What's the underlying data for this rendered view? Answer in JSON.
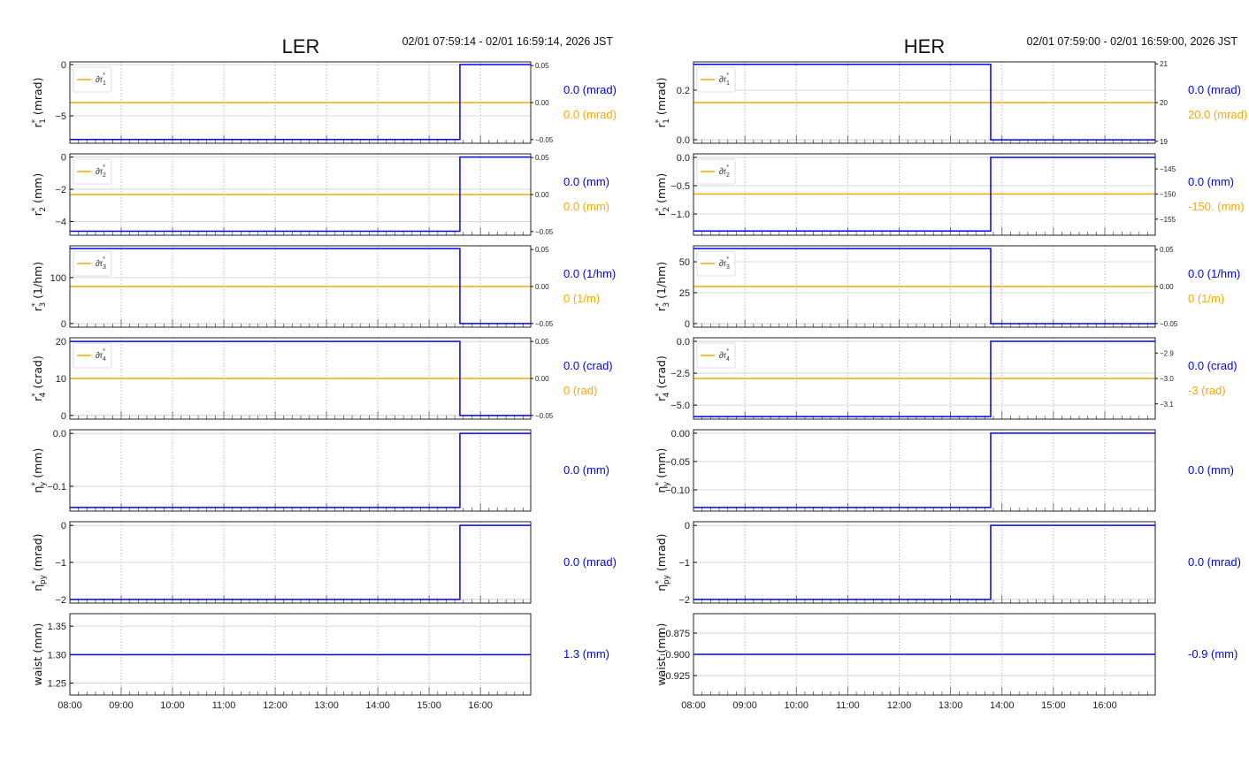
{
  "colors": {
    "primary": "#0000ff",
    "secondary": "#ffa500",
    "grid": "#cccccc"
  },
  "chart_data": [
    {
      "type": "line",
      "title": "LER",
      "time_range": "02/01 07:59:14 - 02/01 16:59:14, 2026 JST",
      "xlim_hours": [
        8.0,
        16.98
      ],
      "xticks": [
        {
          "v": 8,
          "label": "08:00"
        },
        {
          "v": 9,
          "label": "09:00"
        },
        {
          "v": 10,
          "label": "10:00"
        },
        {
          "v": 11,
          "label": "11:00"
        },
        {
          "v": 12,
          "label": "12:00"
        },
        {
          "v": 13,
          "label": "13:00"
        },
        {
          "v": 14,
          "label": "14:00"
        },
        {
          "v": 15,
          "label": "15:00"
        },
        {
          "v": 16,
          "label": "16:00"
        }
      ],
      "subplots": [
        {
          "ylabel": {
            "sym": "r",
            "sup": "*",
            "sub": "1",
            "unit": " (mrad)"
          },
          "ylim": [
            -7.67,
            0.26
          ],
          "yticks": [
            {
              "v": 0,
              "label": "0"
            },
            {
              "v": -5,
              "label": "−5"
            }
          ],
          "blue": {
            "x": [
              8.0,
              15.6,
              16.98
            ],
            "y": [
              -7.3,
              0.0,
              0.0
            ]
          },
          "orange": {
            "value": 0.0,
            "right_ylim": [
              -0.055,
              0.055
            ],
            "right_ticks": [
              {
                "v": 0.05,
                "label": "0.05"
              },
              {
                "v": 0.0,
                "label": "0.00"
              },
              {
                "v": -0.05,
                "label": "−0.05"
              }
            ]
          },
          "legend": {
            "sym": "∂r",
            "sup": "*",
            "sub": "1"
          },
          "annotations": {
            "blue": "0.0 (mrad)",
            "orange": "0.0 (mrad)"
          }
        },
        {
          "ylabel": {
            "sym": "r",
            "sup": "*",
            "sub": "2",
            "unit": " (mm)"
          },
          "ylim": [
            -4.85,
            0.2
          ],
          "yticks": [
            {
              "v": 0,
              "label": "0"
            },
            {
              "v": -2,
              "label": "−2"
            },
            {
              "v": -4,
              "label": "−4"
            }
          ],
          "blue": {
            "x": [
              8.0,
              15.6,
              16.98
            ],
            "y": [
              -4.6,
              0.0,
              0.0
            ]
          },
          "orange": {
            "value": 0.0,
            "right_ylim": [
              -0.055,
              0.055
            ],
            "right_ticks": [
              {
                "v": 0.05,
                "label": "0.05"
              },
              {
                "v": 0.0,
                "label": "0.00"
              },
              {
                "v": -0.05,
                "label": "−0.05"
              }
            ]
          },
          "legend": {
            "sym": "∂r",
            "sup": "*",
            "sub": "2"
          },
          "annotations": {
            "blue": "0.0 (mm)",
            "orange": "0.0 (mm)"
          }
        },
        {
          "ylabel": {
            "sym": "r",
            "sup": "*",
            "sub": "3",
            "unit": " (1/hm)"
          },
          "ylim": [
            -8,
            169
          ],
          "yticks": [
            {
              "v": 100,
              "label": "100"
            },
            {
              "v": 0,
              "label": "0"
            }
          ],
          "blue": {
            "x": [
              8.0,
              15.6,
              16.98
            ],
            "y": [
              163,
              0.0,
              0.0
            ]
          },
          "orange": {
            "value": 0.0,
            "right_ylim": [
              -0.055,
              0.055
            ],
            "right_ticks": [
              {
                "v": 0.05,
                "label": "0.05"
              },
              {
                "v": 0.0,
                "label": "0.00"
              },
              {
                "v": -0.05,
                "label": "−0.05"
              }
            ]
          },
          "legend": {
            "sym": "∂r",
            "sup": "*",
            "sub": "3"
          },
          "annotations": {
            "blue": "0.0 (1/hm)",
            "orange": "0 (1/m)"
          }
        },
        {
          "ylabel": {
            "sym": "r",
            "sup": "*",
            "sub": "4",
            "unit": " (crad)"
          },
          "ylim": [
            -1,
            21
          ],
          "yticks": [
            {
              "v": 20,
              "label": "20"
            },
            {
              "v": 10,
              "label": "10"
            },
            {
              "v": 0,
              "label": "0"
            }
          ],
          "blue": {
            "x": [
              8.0,
              15.6,
              16.98
            ],
            "y": [
              20,
              0.0,
              0.0
            ]
          },
          "orange": {
            "value": 0.0,
            "right_ylim": [
              -0.055,
              0.055
            ],
            "right_ticks": [
              {
                "v": 0.05,
                "label": "0.05"
              },
              {
                "v": 0.0,
                "label": "0.00"
              },
              {
                "v": -0.05,
                "label": "−0.05"
              }
            ]
          },
          "legend": {
            "sym": "∂r",
            "sup": "*",
            "sub": "4"
          },
          "annotations": {
            "blue": "0.0 (crad)",
            "orange": "0 (rad)"
          }
        },
        {
          "ylabel": {
            "sym": "η",
            "sup": "*",
            "sub": "y",
            "unit": " (mm)"
          },
          "ylim": [
            -0.147,
            0.007
          ],
          "yticks": [
            {
              "v": 0,
              "label": "0.0"
            },
            {
              "v": -0.1,
              "label": "−0.1"
            }
          ],
          "blue": {
            "x": [
              8.0,
              15.6,
              16.98
            ],
            "y": [
              -0.14,
              0.0,
              0.0
            ]
          },
          "annotations": {
            "blue": "0.0 (mm)"
          }
        },
        {
          "ylabel": {
            "sym": "η",
            "sup": "*",
            "sub": "py",
            "unit": " (mrad)"
          },
          "ylim": [
            -2.1,
            0.1
          ],
          "yticks": [
            {
              "v": 0,
              "label": "0"
            },
            {
              "v": -1,
              "label": "−1"
            },
            {
              "v": -2,
              "label": "−2"
            }
          ],
          "blue": {
            "x": [
              8.0,
              15.6,
              16.98
            ],
            "y": [
              -2.0,
              0.0,
              0.0
            ]
          },
          "annotations": {
            "blue": "0.0 (mrad)"
          }
        },
        {
          "ylabel": {
            "sym": "waist",
            "sup": "",
            "sub": "",
            "unit": " (mm)"
          },
          "ylim": [
            1.229,
            1.372
          ],
          "yticks": [
            {
              "v": 1.35,
              "label": "1.35"
            },
            {
              "v": 1.3,
              "label": "1.30"
            },
            {
              "v": 1.25,
              "label": "1.25"
            }
          ],
          "blue": {
            "x": [
              8.0,
              16.98
            ],
            "y": [
              1.3,
              1.3
            ]
          },
          "annotations": {
            "blue": "1.3 (mm)"
          }
        }
      ]
    },
    {
      "type": "line",
      "title": "HER",
      "time_range": "02/01 07:59:00 - 02/01 16:59:00, 2026 JST",
      "xlim_hours": [
        8.0,
        16.98
      ],
      "xticks": [
        {
          "v": 8,
          "label": "08:00"
        },
        {
          "v": 9,
          "label": "09:00"
        },
        {
          "v": 10,
          "label": "10:00"
        },
        {
          "v": 11,
          "label": "11:00"
        },
        {
          "v": 12,
          "label": "12:00"
        },
        {
          "v": 13,
          "label": "13:00"
        },
        {
          "v": 14,
          "label": "14:00"
        },
        {
          "v": 15,
          "label": "15:00"
        },
        {
          "v": 16,
          "label": "16:00"
        }
      ],
      "subplots": [
        {
          "ylabel": {
            "sym": "r",
            "sup": "*",
            "sub": "1",
            "unit": " (mrad)"
          },
          "ylim": [
            -0.014,
            0.314
          ],
          "yticks": [
            {
              "v": 0.2,
              "label": "0.2"
            },
            {
              "v": 0.0,
              "label": "0.0"
            }
          ],
          "blue": {
            "x": [
              8.0,
              13.78,
              16.98
            ],
            "y": [
              0.304,
              0.0,
              0.0
            ]
          },
          "orange": {
            "value": 20.0,
            "right_ylim": [
              18.95,
              21.05
            ],
            "right_ticks": [
              {
                "v": 21,
                "label": "21"
              },
              {
                "v": 20,
                "label": "20"
              },
              {
                "v": 19,
                "label": "19"
              }
            ]
          },
          "legend": {
            "sym": "∂r",
            "sup": "*",
            "sub": "1"
          },
          "annotations": {
            "blue": "0.0 (mrad)",
            "orange": "20.0 (mrad)"
          }
        },
        {
          "ylabel": {
            "sym": "r",
            "sup": "*",
            "sub": "2",
            "unit": " (mm)"
          },
          "ylim": [
            -1.375,
            0.0625
          ],
          "yticks": [
            {
              "v": 0.0,
              "label": "0.0"
            },
            {
              "v": -0.5,
              "label": "−0.5"
            },
            {
              "v": -1.0,
              "label": "−1.0"
            }
          ],
          "blue": {
            "x": [
              8.0,
              13.78,
              16.98
            ],
            "y": [
              -1.3,
              0.0,
              0.0
            ]
          },
          "orange": {
            "value": -150,
            "right_ylim": [
              -158.2,
              -142.0
            ],
            "right_ticks": [
              {
                "v": -145,
                "label": "−145"
              },
              {
                "v": -150,
                "label": "−150"
              },
              {
                "v": -155,
                "label": "−155"
              }
            ]
          },
          "legend": {
            "sym": "∂r",
            "sup": "*",
            "sub": "2"
          },
          "annotations": {
            "blue": "0.0 (mm)",
            "orange": "-150. (mm)"
          }
        },
        {
          "ylabel": {
            "sym": "r",
            "sup": "*",
            "sub": "3",
            "unit": " (1/hm)"
          },
          "ylim": [
            -2.9,
            62.9
          ],
          "yticks": [
            {
              "v": 50,
              "label": "50"
            },
            {
              "v": 25,
              "label": "25"
            },
            {
              "v": 0,
              "label": "0"
            }
          ],
          "blue": {
            "x": [
              8.0,
              13.78,
              16.98
            ],
            "y": [
              60.7,
              0.0,
              0.0
            ]
          },
          "orange": {
            "value": 0.0,
            "right_ylim": [
              -0.055,
              0.055
            ],
            "right_ticks": [
              {
                "v": 0.05,
                "label": "0.05"
              },
              {
                "v": 0.0,
                "label": "0.00"
              },
              {
                "v": -0.05,
                "label": "−0.05"
              }
            ]
          },
          "legend": {
            "sym": "∂r",
            "sup": "*",
            "sub": "3"
          },
          "annotations": {
            "blue": "0.0 (1/hm)",
            "orange": "0 (1/m)"
          }
        },
        {
          "ylabel": {
            "sym": "r",
            "sup": "*",
            "sub": "4",
            "unit": " (crad)"
          },
          "ylim": [
            -6.1,
            0.28
          ],
          "yticks": [
            {
              "v": 0.0,
              "label": "0.0"
            },
            {
              "v": -2.5,
              "label": "−2.5"
            },
            {
              "v": -5.0,
              "label": "−5.0"
            }
          ],
          "blue": {
            "x": [
              8.0,
              13.78,
              16.98
            ],
            "y": [
              -5.9,
              0.0,
              0.0
            ]
          },
          "orange": {
            "value": -3.0,
            "right_ylim": [
              -3.16,
              -2.84
            ],
            "right_ticks": [
              {
                "v": -2.9,
                "label": "−2.9"
              },
              {
                "v": -3.0,
                "label": "−3.0"
              },
              {
                "v": -3.1,
                "label": "−3.1"
              }
            ]
          },
          "legend": {
            "sym": "∂r",
            "sup": "*",
            "sub": "4"
          },
          "annotations": {
            "blue": "0.0 (crad)",
            "orange": "-3 (rad)"
          }
        },
        {
          "ylabel": {
            "sym": "η",
            "sup": "*",
            "sub": "y",
            "unit": " (mm)"
          },
          "ylim": [
            -0.1375,
            0.006
          ],
          "yticks": [
            {
              "v": 0.0,
              "label": "0.00"
            },
            {
              "v": -0.05,
              "label": "−0.05"
            },
            {
              "v": -0.1,
              "label": "−0.10"
            }
          ],
          "blue": {
            "x": [
              8.0,
              13.78,
              16.98
            ],
            "y": [
              -0.131,
              0.0,
              0.0
            ]
          },
          "annotations": {
            "blue": "0.0 (mm)"
          }
        },
        {
          "ylabel": {
            "sym": "η",
            "sup": "*",
            "sub": "py",
            "unit": " (mrad)"
          },
          "ylim": [
            -2.1,
            0.1
          ],
          "yticks": [
            {
              "v": 0,
              "label": "0"
            },
            {
              "v": -1,
              "label": "−1"
            },
            {
              "v": -2,
              "label": "−2"
            }
          ],
          "blue": {
            "x": [
              8.0,
              13.78,
              16.98
            ],
            "y": [
              -2.0,
              0.0,
              0.0
            ]
          },
          "annotations": {
            "blue": "0.0 (mrad)"
          }
        },
        {
          "ylabel": {
            "sym": "waist",
            "sup": "",
            "sub": "",
            "unit": " (mm)"
          },
          "ylim": [
            -0.948,
            -0.852
          ],
          "yticks": [
            {
              "v": -0.875,
              "label": "−0.875"
            },
            {
              "v": -0.9,
              "label": "−0.900"
            },
            {
              "v": -0.925,
              "label": "−0.925"
            }
          ],
          "blue": {
            "x": [
              8.0,
              16.98
            ],
            "y": [
              -0.9,
              -0.9
            ]
          },
          "annotations": {
            "blue": "-0.9 (mm)"
          }
        }
      ]
    }
  ]
}
